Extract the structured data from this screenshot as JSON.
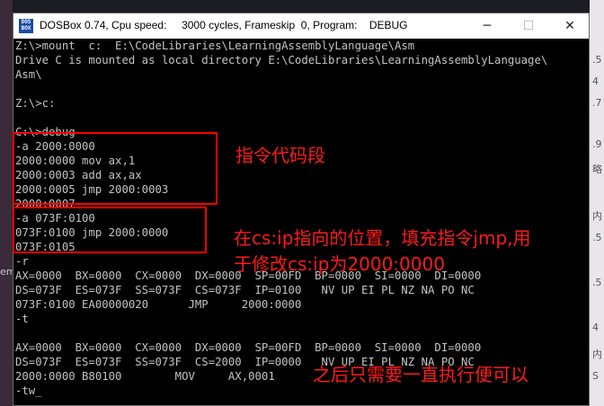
{
  "window": {
    "title": "DOSBox 0.74, Cpu speed:     3000 cycles, Frameskip  0, Program:    DEBUG",
    "icon_text": "DOS BOX",
    "controls": {
      "minimize": "─",
      "maximize": "☐",
      "close": "✕"
    }
  },
  "terminal": {
    "lines": [
      "Z:\\>mount  c:  E:\\CodeLibraries\\LearningAssemblyLanguage\\Asm",
      "Drive C is mounted as local directory E:\\CodeLibraries\\LearningAssemblyLanguage\\",
      "Asm\\",
      "",
      "Z:\\>c:",
      "",
      "C:\\>debug",
      "-a 2000:0000",
      "2000:0000 mov ax,1",
      "2000:0003 add ax,ax",
      "2000:0005 jmp 2000:0003",
      "2000:0007",
      "-a 073F:0100",
      "073F:0100 jmp 2000:0000",
      "073F:0105",
      "-r",
      "AX=0000  BX=0000  CX=0000  DX=0000  SP=00FD  BP=0000  SI=0000  DI=0000",
      "DS=073F  ES=073F  SS=073F  CS=073F  IP=0100   NV UP EI PL NZ NA PO NC",
      "073F:0100 EA00000020      JMP     2000:0000",
      "-t",
      "",
      "AX=0000  BX=0000  CX=0000  DX=0000  SP=00FD  BP=0000  SI=0000  DI=0000",
      "DS=073F  ES=073F  SS=073F  CS=2000  IP=0000   NV UP EI PL NZ NA PO NC",
      "2000:0000 B80100        MOV     AX,0001",
      "-tw_"
    ]
  },
  "annotations": {
    "code_segment": "指令代码段",
    "csip_line1": "在cs:ip指向的位置，填充指令jmp,用",
    "csip_line2": "于修改cs:ip为2000:0000",
    "later": "之后只需要一直执行便可以"
  },
  "background_fragments": [
    ".5",
    "4",
    ".7",
    ".9",
    "略",
    "内",
    ".5",
    ".5",
    "4",
    "内",
    "S"
  ],
  "background_left_fragment": "em",
  "colors": {
    "annotation": "#ff1a1a",
    "terminal_text": "#c4c4c4",
    "terminal_bg": "#000000"
  }
}
